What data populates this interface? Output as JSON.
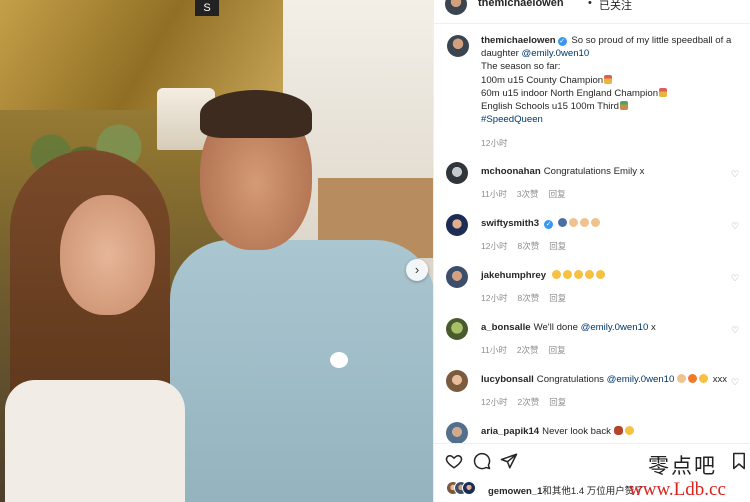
{
  "header": {
    "username": "themichaelowen",
    "separator": "•",
    "follow_status": "已关注"
  },
  "caption": {
    "username": "themichaelowen",
    "text_intro": "So so proud of my little speedball of a daughter",
    "mention": "@emily.0wen10",
    "season_label": "The season so far:",
    "line1": "100m u15 County Champion",
    "line2": "60m u15 indoor North England Champion",
    "line3": "English Schools u15 100m Third",
    "hashtag": "#SpeedQueen",
    "time": "12小时"
  },
  "comments": [
    {
      "user": "mchoonahan",
      "text": "Congratulations Emily x",
      "time": "11小时",
      "likes": "3次赞",
      "reply": "回复"
    },
    {
      "user": "swiftysmith3",
      "text": "",
      "time": "12小时",
      "likes": "8次赞",
      "reply": "回复"
    },
    {
      "user": "jakehumphrey",
      "text": "",
      "time": "12小时",
      "likes": "8次赞",
      "reply": "回复"
    },
    {
      "user": "a_bonsalle",
      "text_pre": "We'll done",
      "mention": "@emily.0wen10",
      "text_post": "x",
      "time": "11小时",
      "likes": "2次赞",
      "reply": "回复"
    },
    {
      "user": "lucybonsall",
      "text_pre": "Congratulations",
      "mention": "@emily.0wen10",
      "text_post": "xxx",
      "time": "12小时",
      "likes": "2次赞",
      "reply": "回复"
    },
    {
      "user": "aria_papik14",
      "text": "Never look back"
    }
  ],
  "likes_line": {
    "user": "gemowen_1",
    "rest": "和其他1.4 万位用户赞了"
  },
  "photo": {
    "sign_text": "S"
  },
  "watermark": {
    "chinese": "零点吧",
    "url": "www.Ldb.cc"
  },
  "colors": {
    "verified": "#3897f0",
    "link": "#00376b",
    "muted": "#8e8e8e",
    "watermark_url": "#d8231f"
  },
  "icons": [
    "next-arrow-icon",
    "verified-icon",
    "heart-icon",
    "comment-icon",
    "share-icon",
    "bookmark-icon",
    "medal-icon"
  ]
}
